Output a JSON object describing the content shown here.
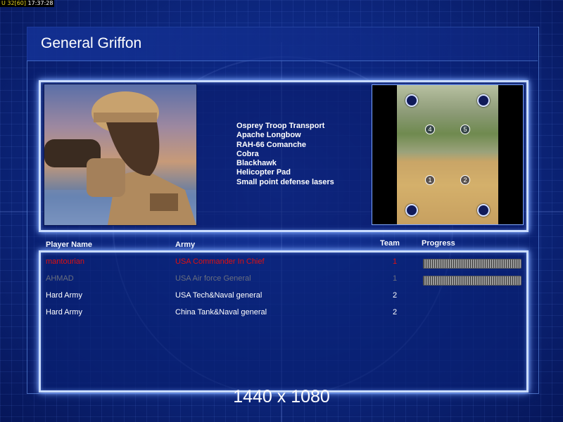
{
  "status_overlay": {
    "fps": "U 32[60]",
    "time": "17:37:28"
  },
  "general": {
    "title": "General Griffon"
  },
  "units": [
    "Osprey Troop Transport",
    "Apache Longbow",
    "RAH-66 Comanche",
    "Cobra",
    "Blackhawk",
    "Helicopter Pad",
    "Small point defense lasers"
  ],
  "map": {
    "start_positions": [
      "1",
      "2",
      "4",
      "5"
    ]
  },
  "columns": {
    "player": "Player Name",
    "army": "Army",
    "team": "Team",
    "progress": "Progress"
  },
  "players": [
    {
      "name": "mantourian",
      "army": "USA Commander In Chief",
      "team": "1",
      "color": "#e01010",
      "progress": 1.0
    },
    {
      "name": "AHMAD",
      "army": "USA Air force General",
      "team": "1",
      "color": "#6a6f7e",
      "progress": 1.0
    },
    {
      "name": "Hard Army",
      "army": "USA Tech&Naval general",
      "team": "2",
      "color": "#ffffff",
      "progress": null
    },
    {
      "name": "Hard Army",
      "army": "China Tank&Naval general",
      "team": "2",
      "color": "#ffffff",
      "progress": null
    }
  ],
  "resolution": "1440 x 1080"
}
